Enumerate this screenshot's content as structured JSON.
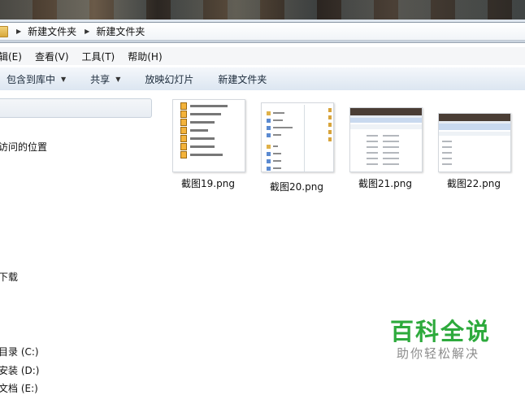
{
  "breadcrumb": {
    "items": [
      "新建文件夹",
      "新建文件夹"
    ]
  },
  "menu": {
    "items": [
      "编辑(E)",
      "查看(V)",
      "工具(T)",
      "帮助(H)"
    ]
  },
  "toolbar": {
    "include_library": "包含到库中",
    "share": "共享",
    "slideshow": "放映幻灯片",
    "new_folder": "新建文件夹"
  },
  "nav": {
    "recent_places": "访问的位置",
    "downloads": "下载",
    "drive_c": "目录 (C:)",
    "drive_d": "安装 (D:)",
    "drive_e": "文档 (E:)"
  },
  "files": [
    {
      "name": "截图19.png"
    },
    {
      "name": "截图20.png"
    },
    {
      "name": "截图21.png"
    },
    {
      "name": "截图22.png"
    }
  ],
  "thumb19": {
    "items": [
      "3D质量角三角形.ai",
      "QQ漂亮表情.ai",
      "彩片效果.ai",
      "流程图.ai",
      "像素名片.ai",
      "图标制作.ai",
      "制作图案文字.ai"
    ]
  },
  "watermark": {
    "title": "百科全说",
    "subtitle": "助你轻松解决"
  },
  "colors": {
    "toolbar_top": "#f4f7fb",
    "toolbar_bottom": "#dce6f1",
    "watermark_green": "#2daa3c",
    "watermark_gray": "#8c8c8c",
    "folder_yellow": "#e0b24a"
  }
}
